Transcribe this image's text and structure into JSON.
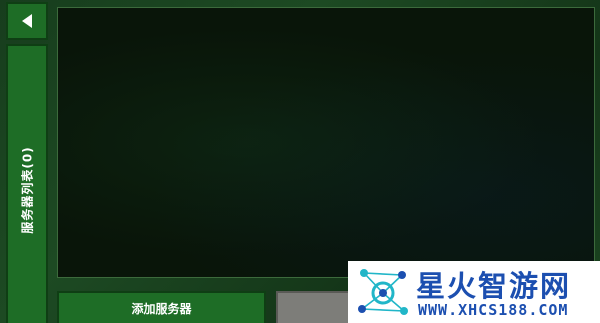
{
  "nav": {
    "back_icon": "chevron-left-icon"
  },
  "sidebar": {
    "server_list_label": "服务器列表(0)"
  },
  "panel": {
    "server_count": 0
  },
  "footer": {
    "add_server_label": "添加服务器"
  },
  "watermark": {
    "title": "星火智游网",
    "url": "WWW.XHCS188.COM"
  },
  "colors": {
    "button_green": "#1e6d26",
    "button_border": "#0f3e14",
    "panel_bg": "#091509",
    "secondary_gray": "#7d7d79",
    "watermark_blue": "#1c4fb0",
    "watermark_accent": "#21b6c8"
  }
}
